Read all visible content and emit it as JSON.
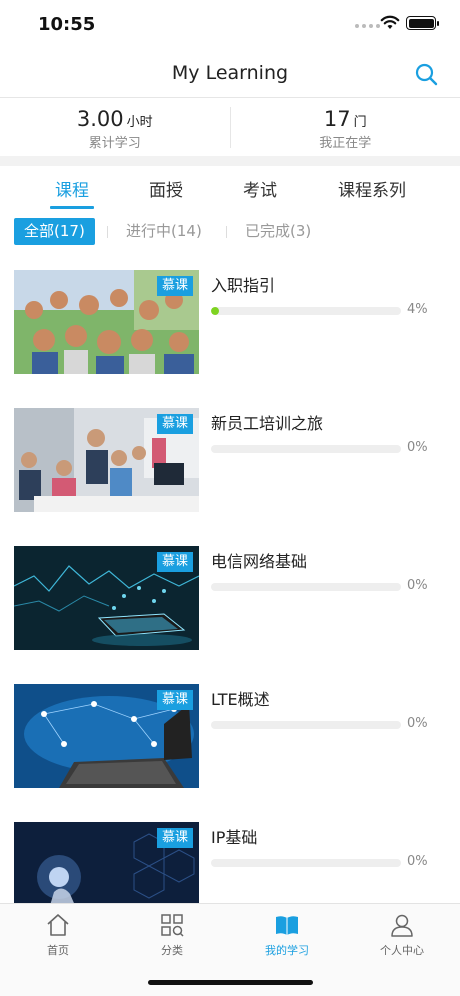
{
  "status_bar": {
    "time": "10:55"
  },
  "nav": {
    "title": "My Learning"
  },
  "stats": [
    {
      "value": "3.00",
      "unit": "小时",
      "label": "累计学习"
    },
    {
      "value": "17",
      "unit": "门",
      "label": "我正在学"
    }
  ],
  "tabs": [
    {
      "label": "课程",
      "active": true
    },
    {
      "label": "面授",
      "active": false
    },
    {
      "label": "考试",
      "active": false
    },
    {
      "label": "课程系列",
      "active": false
    }
  ],
  "filters": [
    {
      "label": "全部(17)",
      "active": true
    },
    {
      "label": "进行中(14)",
      "active": false
    },
    {
      "label": "已完成(3)",
      "active": false
    }
  ],
  "courses": [
    {
      "title": "入职指引",
      "badge": "慕课",
      "progress": 4,
      "progress_label": "4%",
      "image": "people-group-photo"
    },
    {
      "title": "新员工培训之旅",
      "badge": "慕课",
      "progress": 0,
      "progress_label": "0%",
      "image": "office-training-photo"
    },
    {
      "title": "电信网络基础",
      "badge": "慕课",
      "progress": 0,
      "progress_label": "0%",
      "image": "network-phone-graphic"
    },
    {
      "title": "LTE概述",
      "badge": "慕课",
      "progress": 0,
      "progress_label": "0%",
      "image": "laptop-world-network-graphic"
    },
    {
      "title": "IP基础",
      "badge": "慕课",
      "progress": 0,
      "progress_label": "0%",
      "image": "touch-hexagon-graphic"
    }
  ],
  "tabbar": [
    {
      "label": "首页",
      "icon": "home-icon"
    },
    {
      "label": "分类",
      "icon": "category-icon"
    },
    {
      "label": "我的学习",
      "icon": "book-icon",
      "active": true
    },
    {
      "label": "个人中心",
      "icon": "user-icon"
    }
  ],
  "colors": {
    "accent": "#1a9fe0",
    "progress": "#7ed321"
  }
}
